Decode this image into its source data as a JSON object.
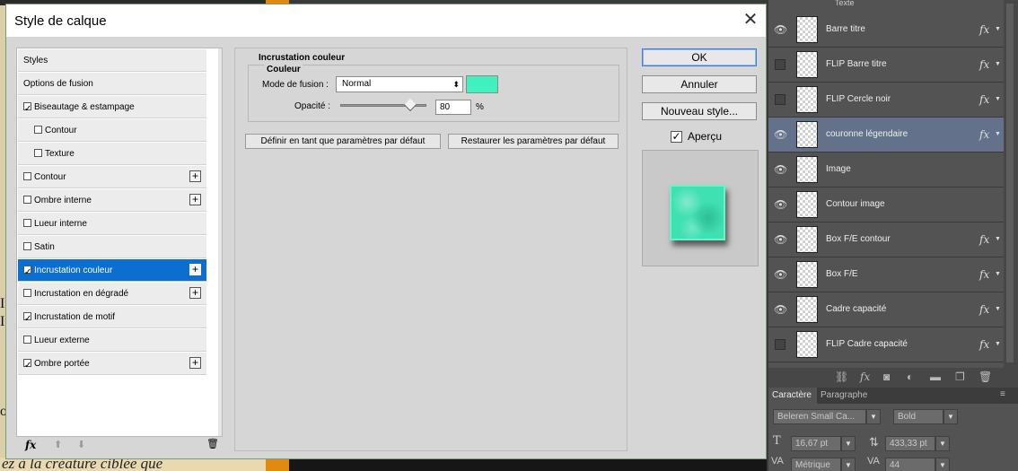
{
  "background": {
    "bottom_text": "ez à la créature ciblée que",
    "left_letters": [
      "I",
      "I",
      "o"
    ]
  },
  "dialog": {
    "title": "Style de calque",
    "close": "✕",
    "styles": [
      {
        "label": "Styles",
        "checkbox": false,
        "checked": false,
        "plus": false,
        "indent": false,
        "selected": false
      },
      {
        "label": "Options de fusion",
        "checkbox": false,
        "checked": false,
        "plus": false,
        "indent": false,
        "selected": false
      },
      {
        "label": "Biseautage & estampage",
        "checkbox": true,
        "checked": true,
        "plus": false,
        "indent": false,
        "selected": false
      },
      {
        "label": "Contour",
        "checkbox": true,
        "checked": false,
        "plus": false,
        "indent": true,
        "selected": false
      },
      {
        "label": "Texture",
        "checkbox": true,
        "checked": false,
        "plus": false,
        "indent": true,
        "selected": false
      },
      {
        "label": "Contour",
        "checkbox": true,
        "checked": false,
        "plus": true,
        "indent": false,
        "selected": false
      },
      {
        "label": "Ombre interne",
        "checkbox": true,
        "checked": false,
        "plus": true,
        "indent": false,
        "selected": false
      },
      {
        "label": "Lueur interne",
        "checkbox": true,
        "checked": false,
        "plus": false,
        "indent": false,
        "selected": false
      },
      {
        "label": "Satin",
        "checkbox": true,
        "checked": false,
        "plus": false,
        "indent": false,
        "selected": false
      },
      {
        "label": "Incrustation couleur",
        "checkbox": true,
        "checked": true,
        "plus": true,
        "indent": false,
        "selected": true
      },
      {
        "label": "Incrustation en dégradé",
        "checkbox": true,
        "checked": false,
        "plus": true,
        "indent": false,
        "selected": false
      },
      {
        "label": "Incrustation de motif",
        "checkbox": true,
        "checked": true,
        "plus": false,
        "indent": false,
        "selected": false
      },
      {
        "label": "Lueur externe",
        "checkbox": true,
        "checked": false,
        "plus": false,
        "indent": false,
        "selected": false
      },
      {
        "label": "Ombre portée",
        "checkbox": true,
        "checked": true,
        "plus": true,
        "indent": false,
        "selected": false
      }
    ],
    "list_footer": {
      "fx": "fx",
      "up": "⬆",
      "down": "⬇",
      "trash": "🗑"
    },
    "section_title": "Incrustation couleur",
    "group_title": "Couleur",
    "blend_label": "Mode de fusion :",
    "blend_value": "Normal",
    "blend_arrow": "⬍",
    "color_swatch": "#40f0bf",
    "opacity_label": "Opacité :",
    "opacity_value": "80",
    "opacity_unit": "%",
    "btn_default": "Définir en tant que paramètres par défaut",
    "btn_restore": "Restaurer les paramètres par défaut",
    "ok": "OK",
    "cancel": "Annuler",
    "new_style": "Nouveau style...",
    "preview_label": "Aperçu",
    "preview_checked": "✓"
  },
  "layers": {
    "group_header": "Texte",
    "items": [
      {
        "name": "Barre titre",
        "visible": true,
        "fx": true,
        "selected": false
      },
      {
        "name": "FLIP Barre titre",
        "visible": false,
        "fx": true,
        "selected": false
      },
      {
        "name": "FLIP Cercle noir",
        "visible": false,
        "fx": true,
        "selected": false
      },
      {
        "name": "couronne légendaire",
        "visible": true,
        "fx": true,
        "selected": true
      },
      {
        "name": "Image",
        "visible": true,
        "fx": false,
        "selected": false
      },
      {
        "name": "Contour image",
        "visible": true,
        "fx": false,
        "selected": false
      },
      {
        "name": "Box F/E contour",
        "visible": true,
        "fx": true,
        "selected": false
      },
      {
        "name": "Box F/E",
        "visible": true,
        "fx": true,
        "selected": false
      },
      {
        "name": "Cadre capacité",
        "visible": true,
        "fx": true,
        "selected": false
      },
      {
        "name": "FLIP Cadre capacité",
        "visible": false,
        "fx": true,
        "selected": false
      }
    ]
  },
  "character": {
    "tab_char": "Caractère",
    "tab_para": "Paragraphe",
    "font_family": "Beleren Small Ca...",
    "font_style": "Bold",
    "font_size": "16,67 pt",
    "leading": "433,33 pt",
    "kerning": "Métrique",
    "tracking": "44"
  }
}
